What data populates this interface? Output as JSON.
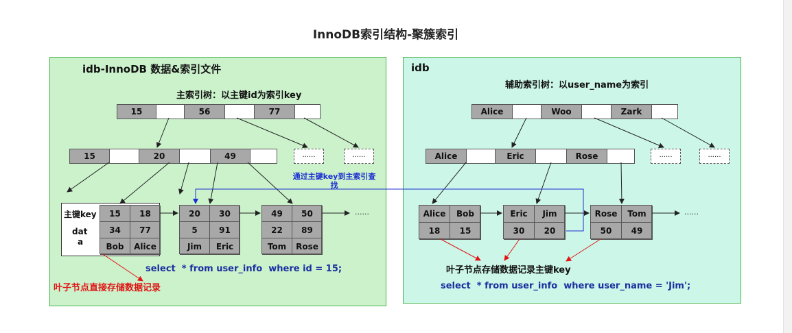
{
  "title": "InnoDB索引结构-聚簇索引",
  "left_panel": {
    "title": "idb-InnoDB 数据&索引文件",
    "tree_label": "主索引树：以主键id为索引key",
    "root_keys": [
      "15",
      "56",
      "77"
    ],
    "level2_keys": [
      "15",
      "20",
      "49"
    ],
    "dots": "......",
    "key_label": "主键key",
    "data_label_1": "dat",
    "data_label_2": "a",
    "leaves": [
      {
        "keys": [
          "15",
          "18"
        ],
        "nums": [
          "34",
          "77"
        ],
        "names": [
          "Bob",
          "Alice"
        ]
      },
      {
        "keys": [
          "20",
          "30"
        ],
        "nums": [
          "5",
          "91"
        ],
        "names": [
          "Jim",
          "Eric"
        ]
      },
      {
        "keys": [
          "49",
          "50"
        ],
        "nums": [
          "22",
          "89"
        ],
        "names": [
          "Tom",
          "Rose"
        ]
      }
    ],
    "leaf_ellipsis": "......",
    "sql": "select  * from user_info  where id = 15;",
    "red_note": "叶子节点直接存储数据记录"
  },
  "lookup_note_line1": "通过主键key到主索引查",
  "lookup_note_line2": "找",
  "right_panel": {
    "title": "idb",
    "tree_label": "辅助索引树：以user_name为索引",
    "root_keys": [
      "Alice",
      "Woo",
      "Zark"
    ],
    "level2_keys": [
      "Alice",
      "Eric",
      "Rose"
    ],
    "dots": "......",
    "leaves": [
      {
        "names": [
          "Alice",
          "Bob"
        ],
        "ids": [
          "18",
          "15"
        ]
      },
      {
        "names": [
          "Eric",
          "Jim"
        ],
        "ids": [
          "30",
          "20"
        ]
      },
      {
        "names": [
          "Rose",
          "Tom"
        ],
        "ids": [
          "50",
          "49"
        ]
      }
    ],
    "leaf_ellipsis": "......",
    "note": "叶子节点存储数据记录主键key",
    "sql": "select  * from user_info  where user_name = 'Jim';"
  },
  "colors": {
    "left_panel_bg": "#ccf2cc",
    "right_panel_bg": "#ccf6e8",
    "panel_border": "#47b24a",
    "key_cell": "#a8a8a8",
    "sql_text": "#1b2fa0",
    "red_note": "#e01515",
    "lookup_arrow": "#1b2fd0"
  }
}
